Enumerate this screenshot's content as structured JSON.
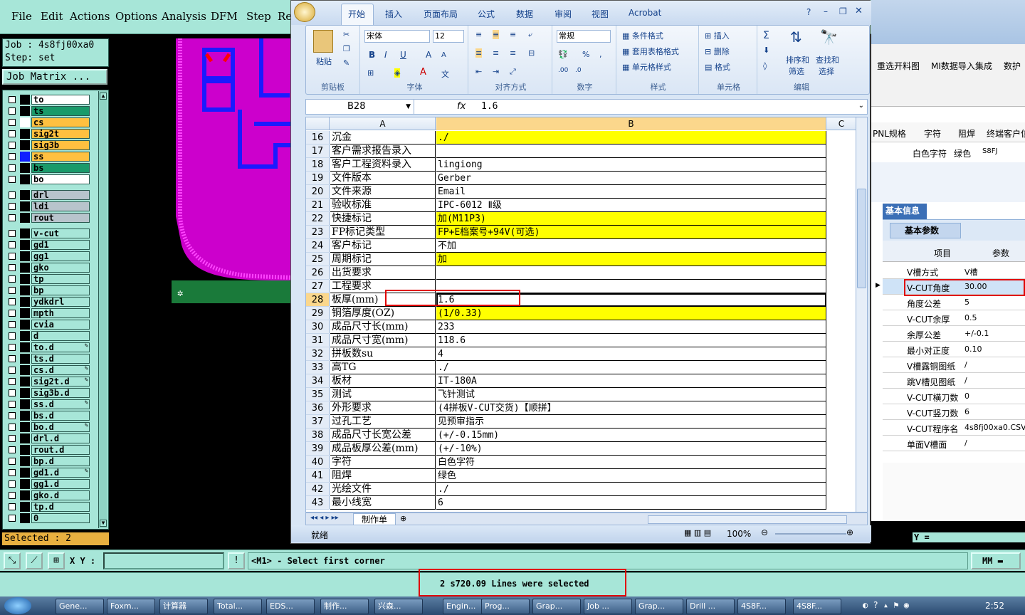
{
  "genesis": {
    "menu": [
      "File",
      "Edit",
      "Actions",
      "Options",
      "Analysis",
      "DFM",
      "Step",
      "Re"
    ],
    "job_label": "Job : 4s8fj00xa0",
    "step_label": "Step: set",
    "job_matrix_button": "Job Matrix ...",
    "selected": "Selected : 2",
    "xy_label": "X Y :",
    "prompt": "<M1> - Select first corner",
    "status": "2 s720.09 Lines were selected",
    "units": "MM",
    "coord_y": "Y =",
    "layers": [
      {
        "name": "to",
        "color": "#ffffff",
        "swatch": "#000000"
      },
      {
        "name": "ts",
        "color": "#1a9a6a",
        "swatch": "#000000"
      },
      {
        "name": "cs",
        "color": "#ffc040",
        "swatch": "#ffffff"
      },
      {
        "name": "sig2t",
        "color": "#ffc040",
        "swatch": "#000000"
      },
      {
        "name": "sig3b",
        "color": "#ffc040",
        "swatch": "#000000"
      },
      {
        "name": "ss",
        "color": "#ffc040",
        "swatch": "#1020ff"
      },
      {
        "name": "bs",
        "color": "#1a9a6a",
        "swatch": "#000000"
      },
      {
        "name": "bo",
        "color": "#ffffff",
        "swatch": "#000000"
      },
      {
        "name": "drl",
        "color": "#b8c4cc",
        "swatch": "#000000"
      },
      {
        "name": "ldi",
        "color": "#b8c4cc",
        "swatch": "#000000"
      },
      {
        "name": "rout",
        "color": "#b8c4cc",
        "swatch": "#000000"
      },
      {
        "name": "v-cut",
        "color": "#a7e6d8",
        "swatch": "#000000"
      },
      {
        "name": "gd1",
        "color": "#a7e6d8",
        "swatch": "#000000"
      },
      {
        "name": "gg1",
        "color": "#a7e6d8",
        "swatch": "#000000"
      },
      {
        "name": "gko",
        "color": "#a7e6d8",
        "swatch": "#000000"
      },
      {
        "name": "tp",
        "color": "#a7e6d8",
        "swatch": "#000000"
      },
      {
        "name": "bp",
        "color": "#a7e6d8",
        "swatch": "#000000"
      },
      {
        "name": "ydkdrl",
        "color": "#a7e6d8",
        "swatch": "#000000"
      },
      {
        "name": "mpth",
        "color": "#a7e6d8",
        "swatch": "#000000"
      },
      {
        "name": "cvia",
        "color": "#a7e6d8",
        "swatch": "#000000"
      },
      {
        "name": "d",
        "color": "#a7e6d8",
        "swatch": "#000000"
      },
      {
        "name": "to.d",
        "color": "#a7e6d8",
        "swatch": "#000000"
      },
      {
        "name": "ts.d",
        "color": "#a7e6d8",
        "swatch": "#000000"
      },
      {
        "name": "cs.d",
        "color": "#a7e6d8",
        "swatch": "#000000"
      },
      {
        "name": "sig2t.d",
        "color": "#a7e6d8",
        "swatch": "#000000"
      },
      {
        "name": "sig3b.d",
        "color": "#a7e6d8",
        "swatch": "#000000"
      },
      {
        "name": "ss.d",
        "color": "#a7e6d8",
        "swatch": "#000000"
      },
      {
        "name": "bs.d",
        "color": "#a7e6d8",
        "swatch": "#000000"
      },
      {
        "name": "bo.d",
        "color": "#a7e6d8",
        "swatch": "#000000"
      },
      {
        "name": "drl.d",
        "color": "#a7e6d8",
        "swatch": "#000000"
      },
      {
        "name": "rout.d",
        "color": "#a7e6d8",
        "swatch": "#000000"
      },
      {
        "name": "bp.d",
        "color": "#a7e6d8",
        "swatch": "#000000"
      },
      {
        "name": "gd1.d",
        "color": "#a7e6d8",
        "swatch": "#000000"
      },
      {
        "name": "gg1.d",
        "color": "#a7e6d8",
        "swatch": "#000000"
      },
      {
        "name": "gko.d",
        "color": "#a7e6d8",
        "swatch": "#000000"
      },
      {
        "name": "tp.d",
        "color": "#a7e6d8",
        "swatch": "#000000"
      },
      {
        "name": "0",
        "color": "#a7e6d8",
        "swatch": "#000000"
      }
    ]
  },
  "excel": {
    "tabs": [
      "开始",
      "插入",
      "页面布局",
      "公式",
      "数据",
      "审阅",
      "视图",
      "Acrobat"
    ],
    "ribbon": {
      "clipboard": {
        "paste": "粘贴",
        "label": "剪贴板"
      },
      "font": {
        "name": "宋体",
        "size": "12",
        "label": "字体"
      },
      "align": {
        "label": "对齐方式"
      },
      "number": {
        "format": "常规",
        "label": "数字"
      },
      "styles": {
        "cond": "条件格式",
        "table": "套用表格格式",
        "cell": "单元格样式",
        "label": "样式"
      },
      "cells": {
        "insert": "插入",
        "delete": "删除",
        "format": "格式",
        "label": "单元格"
      },
      "edit": {
        "sort": "排序和",
        "sort2": "筛选",
        "find": "查找和",
        "find2": "选择",
        "label": "编辑"
      }
    },
    "namebox": "B28",
    "fx": "fx",
    "formula_value": "1.6",
    "columns": [
      "A",
      "B",
      "C"
    ],
    "rows": [
      {
        "n": "16",
        "a": "沉金",
        "b": "./",
        "yellow": true
      },
      {
        "n": "17",
        "a": "客户需求报告录入",
        "b": "",
        "yellow": false
      },
      {
        "n": "18",
        "a": "客户工程资料录入",
        "b": "lingiong",
        "yellow": false
      },
      {
        "n": "19",
        "a": "文件版本",
        "b": "Gerber",
        "yellow": false
      },
      {
        "n": "20",
        "a": "文件来源",
        "b": "Email",
        "yellow": false
      },
      {
        "n": "21",
        "a": "验收标准",
        "b": "IPC-6012 Ⅱ级",
        "yellow": false
      },
      {
        "n": "22",
        "a": "快捷标记",
        "b": "加(M11P3)",
        "yellow": true
      },
      {
        "n": "23",
        "a": "FP标记类型",
        "b": "FP+E档案号+94V(可选)",
        "yellow": true
      },
      {
        "n": "24",
        "a": "客户标记",
        "b": "不加",
        "yellow": false
      },
      {
        "n": "25",
        "a": "周期标记",
        "b": "加",
        "yellow": true
      },
      {
        "n": "26",
        "a": "出货要求",
        "b": "",
        "yellow": false
      },
      {
        "n": "27",
        "a": "工程要求",
        "b": "",
        "yellow": false
      },
      {
        "n": "28",
        "a": "板厚(mm)",
        "b": "1.6",
        "yellow": false
      },
      {
        "n": "29",
        "a": "铜箔厚度(OZ)",
        "b": " (1/0.33)",
        "yellow": true
      },
      {
        "n": "30",
        "a": "成品尺寸长(mm)",
        "b": "233",
        "yellow": false
      },
      {
        "n": "31",
        "a": "成品尺寸宽(mm)",
        "b": "118.6",
        "yellow": false
      },
      {
        "n": "32",
        "a": "拼板数su",
        "b": "4",
        "yellow": false
      },
      {
        "n": "33",
        "a": "高TG",
        "b": "./",
        "yellow": false
      },
      {
        "n": "34",
        "a": "板材",
        "b": "IT-180A",
        "yellow": false
      },
      {
        "n": "35",
        "a": "测试",
        "b": "飞针测试",
        "yellow": false
      },
      {
        "n": "36",
        "a": "外形要求",
        "b": "(4拼板V-CUT交货)【顺拼】",
        "yellow": false
      },
      {
        "n": "37",
        "a": "过孔工艺",
        "b": "见预审指示",
        "yellow": false
      },
      {
        "n": "38",
        "a": "成品尺寸长宽公差",
        "b": "(+/-0.15mm)",
        "yellow": false
      },
      {
        "n": "39",
        "a": "成品板厚公差(mm)",
        "b": "(+/-10%)",
        "yellow": false
      },
      {
        "n": "40",
        "a": "字符",
        "b": "白色字符",
        "yellow": false
      },
      {
        "n": "41",
        "a": "阻焊",
        "b": "绿色",
        "yellow": false
      },
      {
        "n": "42",
        "a": "光绘文件",
        "b": "./",
        "yellow": false
      },
      {
        "n": "43",
        "a": "最小线宽",
        "b": "6",
        "yellow": false
      }
    ],
    "sheet_tab": "制作单",
    "status": "就绪",
    "zoom": "100%"
  },
  "rightapp": {
    "toolbar": [
      "重选开料图",
      "MI数据导入",
      "集成",
      "数护"
    ],
    "headers": [
      "PNL规格",
      "字符",
      "阻焊",
      "终端客户信"
    ],
    "values": [
      "白色字符",
      "绿色",
      "S8FJ"
    ],
    "info_tab": "基本信息",
    "param_tab": "基本参数",
    "col_item": "项目",
    "col_param": "参数",
    "params": [
      {
        "k": "V槽方式",
        "v": "V槽"
      },
      {
        "k": "V-CUT角度",
        "v": "30.00"
      },
      {
        "k": "角度公差",
        "v": "5"
      },
      {
        "k": "V-CUT余厚",
        "v": "0.5"
      },
      {
        "k": "余厚公差",
        "v": "+/-0.1"
      },
      {
        "k": "最小对正度",
        "v": "0.10"
      },
      {
        "k": "V槽露铜图纸",
        "v": "/"
      },
      {
        "k": "跳V槽见图纸",
        "v": "/"
      },
      {
        "k": "V-CUT横刀数",
        "v": "0"
      },
      {
        "k": "V-CUT竖刀数",
        "v": "6"
      },
      {
        "k": "V-CUT程序名",
        "v": "4s8fj00xa0.CSV"
      },
      {
        "k": "单面V槽面",
        "v": "/"
      }
    ]
  },
  "taskbar": {
    "items": [
      "Gene...",
      "Foxm...",
      "计算器",
      "Total...",
      "EDS...",
      "制作...",
      "兴森...",
      "Engin...",
      "Prog...",
      "Grap...",
      "Job ...",
      "Grap...",
      "Drill ...",
      "4S8F...",
      "4S8F..."
    ],
    "clock": "2:52"
  }
}
